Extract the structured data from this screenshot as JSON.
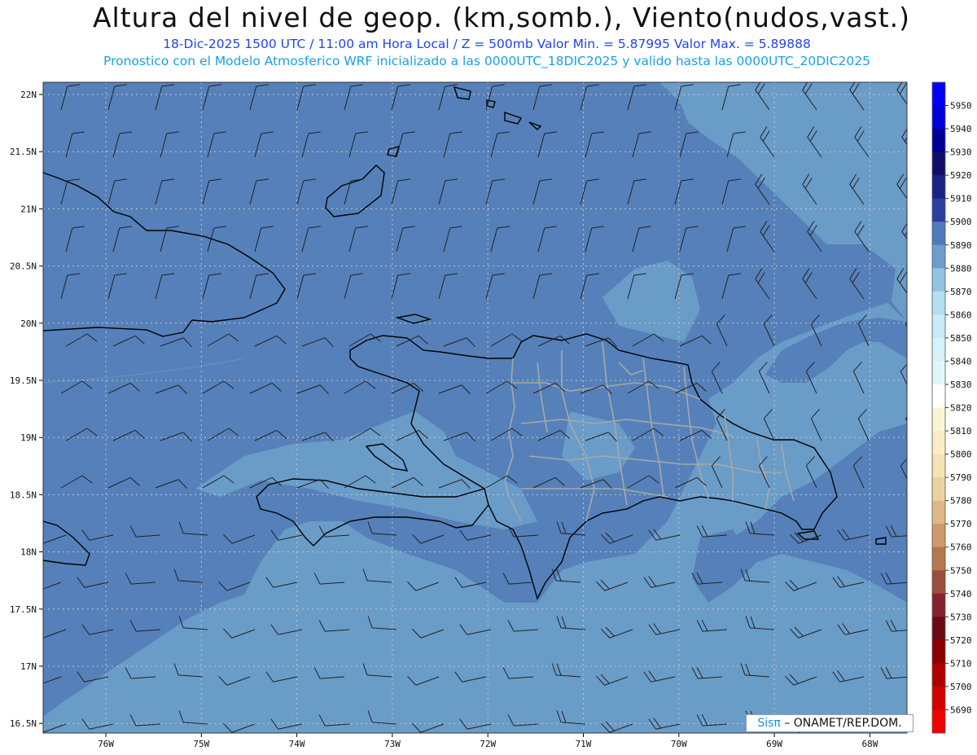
{
  "title": "Altura del nivel de geop. (km,somb.), Viento(nudos,vast.)",
  "subtitle_line1": "18-Dic-2025  1500 UTC / 11:00 am Hora Local / Z = 500mb   Valor Min. = 5.87995  Valor Max. = 5.89888",
  "subtitle_line2": "Pronostico con el Modelo Atmosferico WRF inicializado a las 0000UTC_18DIC2025 y valido hasta las  0000UTC_20DIC2025",
  "lat_labels": [
    "22N",
    "21.5N",
    "21N",
    "20.5N",
    "20N",
    "19.5N",
    "19N",
    "18.5N",
    "18N",
    "17.5N",
    "17N",
    "16.5N"
  ],
  "lon_labels": [
    "76W",
    "75W",
    "74W",
    "73W",
    "72W",
    "71W",
    "70W",
    "69W",
    "68W"
  ],
  "colorbar": {
    "labels": [
      "5950",
      "5940",
      "5930",
      "5920",
      "5910",
      "5900",
      "5890",
      "5880",
      "5870",
      "5860",
      "5850",
      "5840",
      "5830",
      "5820",
      "5810",
      "5800",
      "5790",
      "5780",
      "5770",
      "5760",
      "5750",
      "5740",
      "5730",
      "5720",
      "5710",
      "5700",
      "5690"
    ],
    "colors": [
      "#0000ff",
      "#0000dd",
      "#000099",
      "#10106a",
      "#1a2285",
      "#2a3fa0",
      "#4e7bbd",
      "#6a9fcc",
      "#92c4e2",
      "#b4dff0",
      "#c8ebf5",
      "#d6f1f8",
      "#e0f6fa",
      "#ffffff",
      "#fbf4d2",
      "#f8edc5",
      "#f3e3b4",
      "#ebd3a0",
      "#deb987",
      "#cd9a6b",
      "#b5784e",
      "#9c4e3c",
      "#852130",
      "#6a0a14",
      "#8a0000",
      "#b00000",
      "#d40000",
      "#f00000"
    ]
  },
  "credit": {
    "brand": "Sisπ",
    "text": "– ONAMET/REP.DOM."
  },
  "colors": {
    "field_dark": "#5680b9",
    "field_light": "#6a9cc8",
    "coast": "#000000",
    "borders": "#a8a8a8",
    "grid": "#c0c0c0"
  }
}
